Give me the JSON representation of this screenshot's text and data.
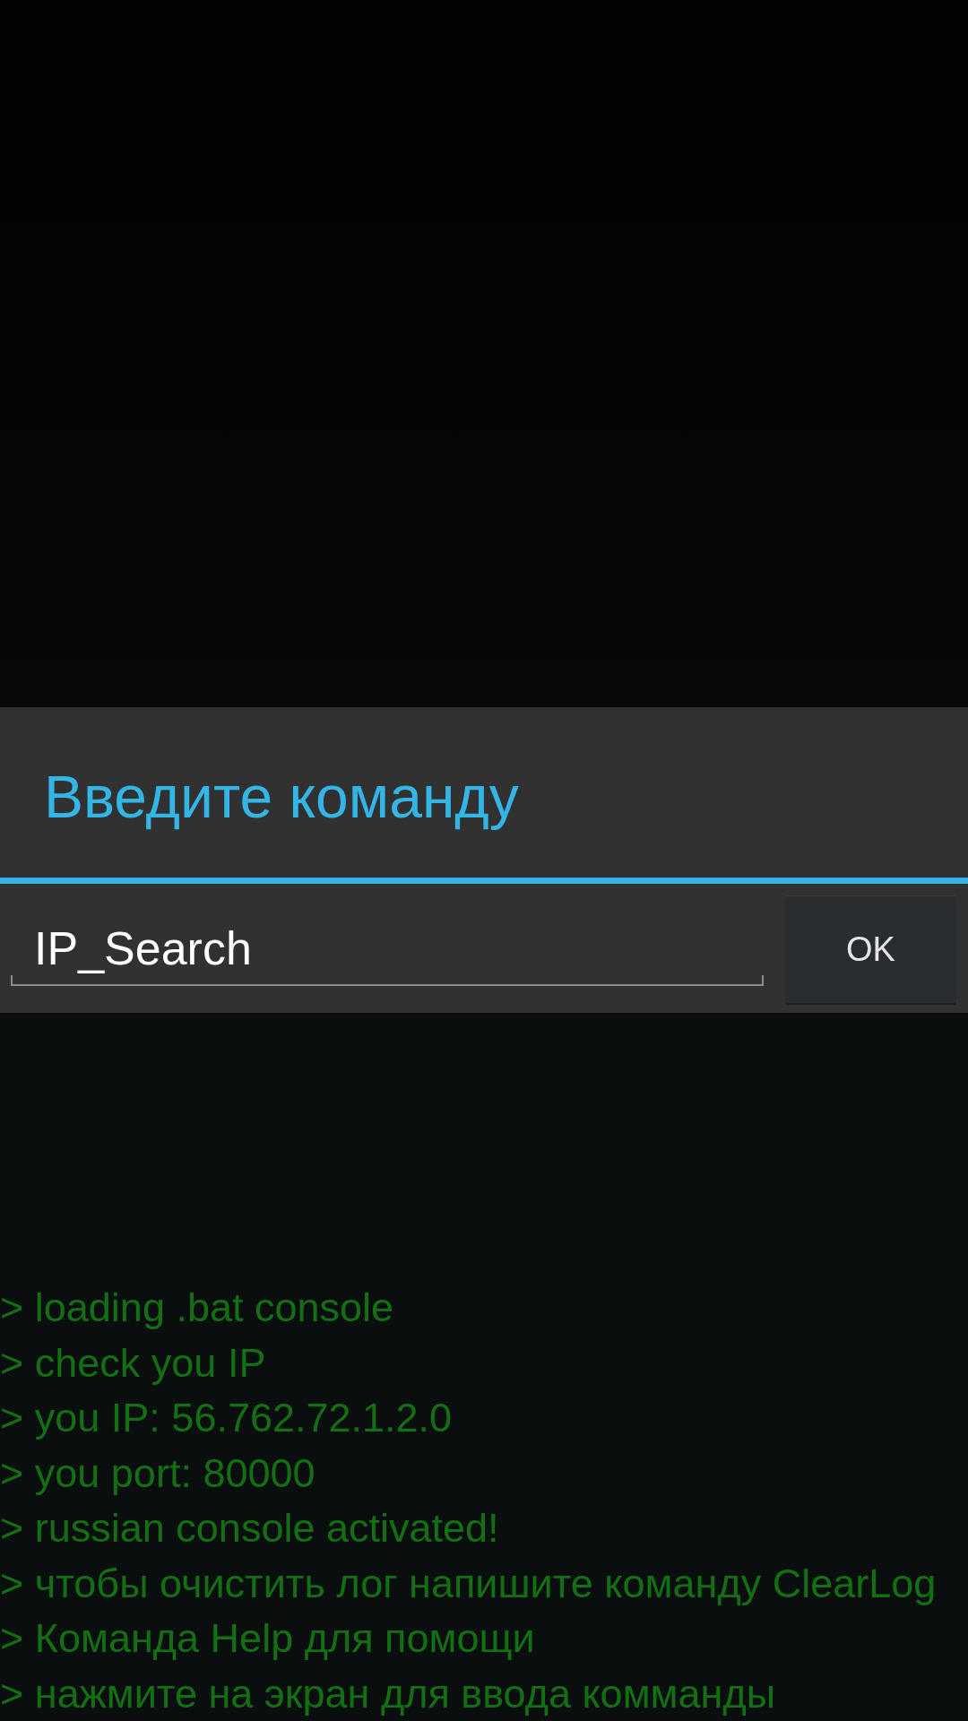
{
  "dialog": {
    "title": "Введите команду",
    "command_input": {
      "value": "IP_Search"
    },
    "ok_button": {
      "label": "OK"
    }
  },
  "console": {
    "lines": [
      "> loading .bat console",
      "> check you IP",
      "> you IP: 56.762.72.1.2.0",
      "> you port: 80000",
      "> russian console activated!",
      "> чтобы очистить лог напишите команду ClearLog",
      "> Команда Help для помощи",
      "> нажмите на экран для ввода комманды"
    ]
  }
}
